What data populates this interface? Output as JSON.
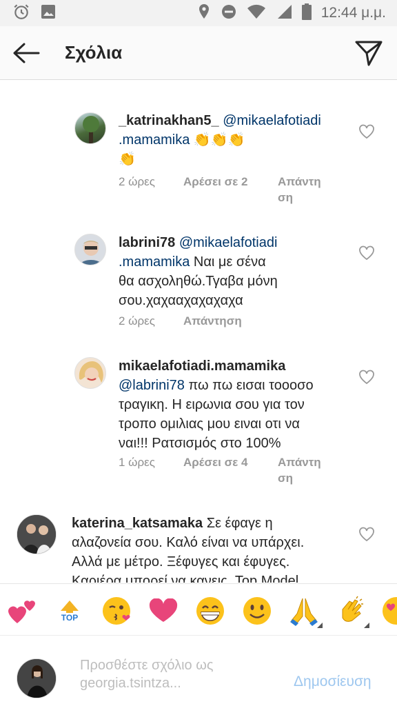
{
  "status_bar": {
    "time": "12:44 μ.μ."
  },
  "header": {
    "title": "Σχόλια"
  },
  "comments": [
    {
      "username": "_katrinakhan5_",
      "mention_line1": "@mikaelafotiadi",
      "mention_line2": ".mamamika",
      "text_tail": "👏👏👏",
      "text_line3": "👏",
      "time": "2 ώρες",
      "likes": "Αρέσει σε 2",
      "reply_line1": "Απάντη",
      "reply_line2": "ση"
    },
    {
      "username": "labrini78",
      "mention_line1": "@mikaelafotiadi",
      "mention_line2": ".mamamika",
      "text_tail": "Ναι με σένα",
      "text_line3": "θα ασχοληθώ.Τγαβα μόνη",
      "text_line4": "σου.χαχααχαχαχαχα",
      "time": "2 ώρες",
      "reply": "Απάντηση"
    },
    {
      "username": "mikaelafotiadi.mamamika",
      "mention": "@labrini78",
      "text_tail": "πω πω εισαι τοοοσο",
      "text_line3": "τραγικη. Η ειρωνια σου για τον",
      "text_line4": "τροπο ομιλιας μου ειναι οτι να",
      "text_line5": "ναι!!! Ρατσισμός στο 100%",
      "time": "1 ώρες",
      "likes": "Αρέσει σε 4",
      "reply_line1": "Απάντη",
      "reply_line2": "ση"
    },
    {
      "username": "katerina_katsamaka",
      "text_tail": "Σε έφαγε η",
      "text_line2": "αλαζονεία σου.  Καλό είναι να υπάρχει.",
      "text_line3": "Αλλά με μέτρο. Ξέφυγες και έφυγες.",
      "text_line4": "Καριέρα μπορεί να κανεις. Top Model"
    }
  ],
  "emoji_bar": {
    "items": [
      "two-hearts",
      "top-arrow",
      "kissing-face",
      "heart",
      "grinning-face",
      "smiling-face",
      "folded-hands",
      "clapping-hands",
      "heart-eyes-face"
    ],
    "top_label": "TOP"
  },
  "compose": {
    "placeholder_line1": "Προσθέστε σχόλιο ως",
    "placeholder_line2": "georgia.tsintza...",
    "post_label": "Δημοσίευση"
  }
}
